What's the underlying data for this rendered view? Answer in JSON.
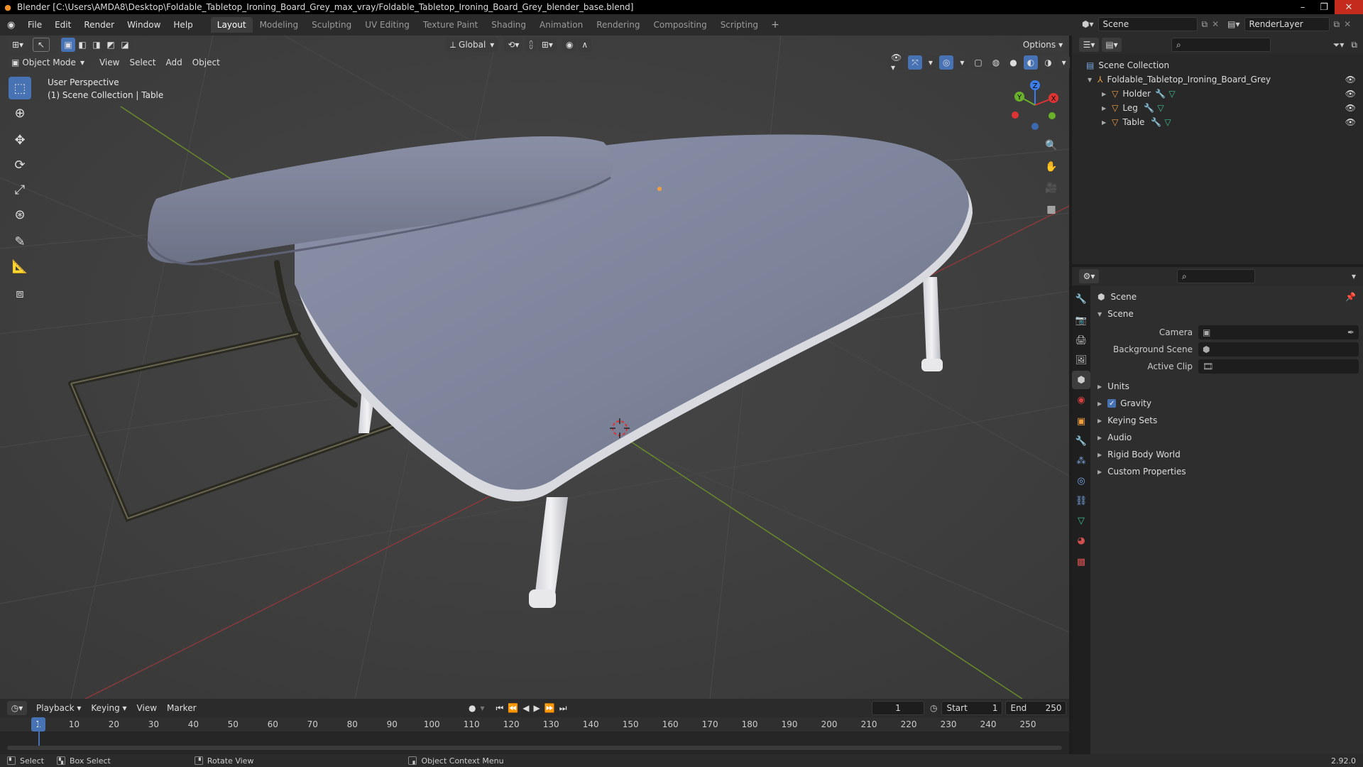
{
  "window": {
    "title": "Blender [C:\\Users\\AMDA8\\Desktop\\Foldable_Tabletop_Ironing_Board_Grey_max_vray/Foldable_Tabletop_Ironing_Board_Grey_blender_base.blend]"
  },
  "menu": [
    "File",
    "Edit",
    "Render",
    "Window",
    "Help"
  ],
  "workspaces": [
    {
      "label": "Layout",
      "active": true
    },
    {
      "label": "Modeling"
    },
    {
      "label": "Sculpting"
    },
    {
      "label": "UV Editing"
    },
    {
      "label": "Texture Paint"
    },
    {
      "label": "Shading"
    },
    {
      "label": "Animation"
    },
    {
      "label": "Rendering"
    },
    {
      "label": "Compositing"
    },
    {
      "label": "Scripting"
    }
  ],
  "scene_field": "Scene",
  "render_layer_field": "RenderLayer",
  "viewport": {
    "transform_orientation": "Global",
    "options_label": "Options",
    "mode": "Object Mode",
    "menus": [
      "View",
      "Select",
      "Add",
      "Object"
    ],
    "perspective": "User Perspective",
    "collection_info": "(1) Scene Collection | Table",
    "gizmo_axes": {
      "x": "X",
      "y": "Y",
      "z": "Z"
    }
  },
  "outliner": {
    "root": "Scene Collection",
    "collection": "Foldable_Tabletop_Ironing_Board_Grey",
    "objects": [
      "Holder",
      "Leg",
      "Table"
    ]
  },
  "properties": {
    "context": "Scene",
    "panel_scene": "Scene",
    "camera_label": "Camera",
    "background_scene_label": "Background Scene",
    "active_clip_label": "Active Clip",
    "panels": [
      "Units",
      "Gravity",
      "Keying Sets",
      "Audio",
      "Rigid Body World",
      "Custom Properties"
    ],
    "gravity_checked": true
  },
  "timeline": {
    "menus": [
      "Playback",
      "Keying",
      "View",
      "Marker"
    ],
    "current_frame": "1",
    "start_label": "Start",
    "start_value": "1",
    "end_label": "End",
    "end_value": "250",
    "ruler": [
      "1",
      "10",
      "20",
      "30",
      "40",
      "50",
      "60",
      "70",
      "80",
      "90",
      "100",
      "110",
      "120",
      "130",
      "140",
      "150",
      "160",
      "170",
      "180",
      "190",
      "200",
      "210",
      "220",
      "230",
      "240",
      "250"
    ]
  },
  "statusbar": {
    "select": "Select",
    "box_select": "Box Select",
    "rotate_view": "Rotate View",
    "context_menu": "Object Context Menu",
    "version": "2.92.0"
  }
}
